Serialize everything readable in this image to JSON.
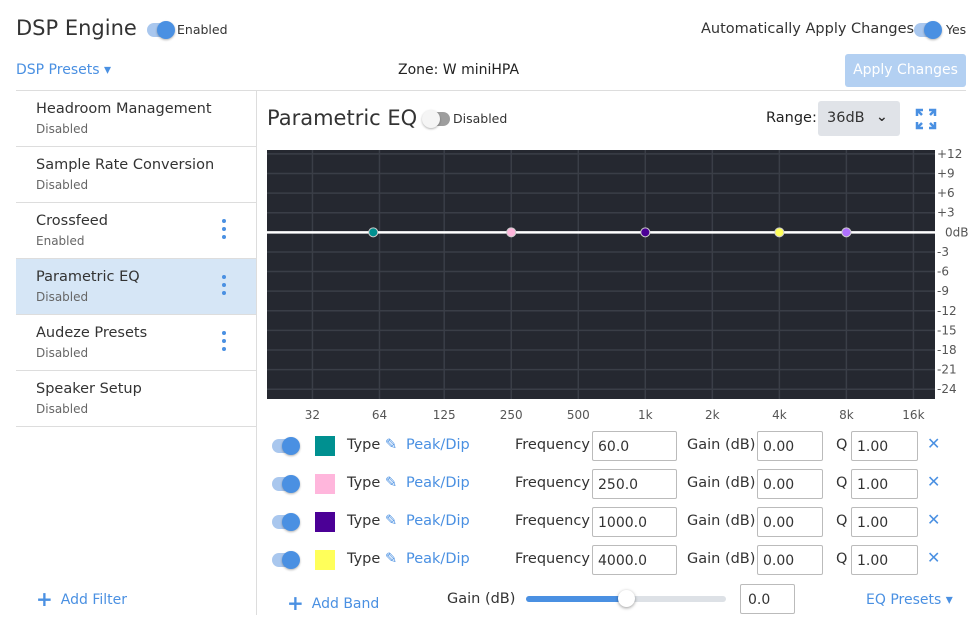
{
  "header": {
    "title": "DSP Engine",
    "engine_toggle": {
      "on": true,
      "label": "Enabled"
    },
    "auto_apply_label": "Automatically Apply Changes",
    "auto_apply_toggle": {
      "on": true,
      "label": "Yes"
    },
    "presets_label": "DSP Presets ▾",
    "zone": "Zone: W miniHPA",
    "apply_label": "Apply Changes"
  },
  "sidebar": {
    "items": [
      {
        "label": "Headroom Management",
        "status": "Disabled",
        "menu": false
      },
      {
        "label": "Sample Rate Conversion",
        "status": "Disabled",
        "menu": false
      },
      {
        "label": "Crossfeed",
        "status": "Enabled",
        "menu": true
      },
      {
        "label": "Parametric EQ",
        "status": "Disabled",
        "menu": true,
        "active": true
      },
      {
        "label": "Audeze Presets",
        "status": "Disabled",
        "menu": true
      },
      {
        "label": "Speaker Setup",
        "status": "Disabled",
        "menu": false
      }
    ],
    "add_filter": "Add Filter"
  },
  "eq": {
    "title": "Parametric EQ",
    "toggle": {
      "on": false,
      "label": "Disabled"
    },
    "range_label": "Range:",
    "range_value": "36dB",
    "expand_icon": "expand-icon"
  },
  "chart_data": {
    "type": "line",
    "x_scale": "log",
    "xlim": [
      20,
      20000
    ],
    "ylim": [
      -25.5,
      12.6
    ],
    "x_ticks": [
      {
        "v": 32,
        "l": "32"
      },
      {
        "v": 64,
        "l": "64"
      },
      {
        "v": 125,
        "l": "125"
      },
      {
        "v": 250,
        "l": "250"
      },
      {
        "v": 500,
        "l": "500"
      },
      {
        "v": 1000,
        "l": "1k"
      },
      {
        "v": 2000,
        "l": "2k"
      },
      {
        "v": 4000,
        "l": "4k"
      },
      {
        "v": 8000,
        "l": "8k"
      },
      {
        "v": 16000,
        "l": "16k"
      }
    ],
    "y_ticks": [
      {
        "v": 12,
        "l": "+12"
      },
      {
        "v": 9,
        "l": "+9"
      },
      {
        "v": 6,
        "l": "+6"
      },
      {
        "v": 3,
        "l": "+3"
      },
      {
        "v": 0,
        "l": "0dB"
      },
      {
        "v": -3,
        "l": "-3"
      },
      {
        "v": -6,
        "l": "-6"
      },
      {
        "v": -9,
        "l": "-9"
      },
      {
        "v": -12,
        "l": "-12"
      },
      {
        "v": -15,
        "l": "-15"
      },
      {
        "v": -18,
        "l": "-18"
      },
      {
        "v": -21,
        "l": "-21"
      },
      {
        "v": -24,
        "l": "-24"
      }
    ],
    "grid": true,
    "background": "#252830",
    "curve_color": "#ffffff",
    "points": [
      {
        "freq": 60,
        "gain": 0,
        "color": "#009090"
      },
      {
        "freq": 250,
        "gain": 0,
        "color": "#ffb6dc"
      },
      {
        "freq": 1000,
        "gain": 0,
        "color": "#4b0096"
      },
      {
        "freq": 4000,
        "gain": 0,
        "color": "#ffff5a"
      },
      {
        "freq": 8000,
        "gain": 0,
        "color": "#b070ff"
      }
    ]
  },
  "bands": [
    {
      "on": true,
      "color": "#009090",
      "type_label": "Type",
      "type": "Peak/Dip",
      "freq_label": "Frequency",
      "freq": "60.0",
      "gain_label": "Gain (dB)",
      "gain": "0.00",
      "q_label": "Q",
      "q": "1.00"
    },
    {
      "on": true,
      "color": "#ffb6dc",
      "type_label": "Type",
      "type": "Peak/Dip",
      "freq_label": "Frequency",
      "freq": "250.0",
      "gain_label": "Gain (dB)",
      "gain": "0.00",
      "q_label": "Q",
      "q": "1.00"
    },
    {
      "on": true,
      "color": "#4b0096",
      "type_label": "Type",
      "type": "Peak/Dip",
      "freq_label": "Frequency",
      "freq": "1000.0",
      "gain_label": "Gain (dB)",
      "gain": "0.00",
      "q_label": "Q",
      "q": "1.00"
    },
    {
      "on": true,
      "color": "#ffff5a",
      "type_label": "Type",
      "type": "Peak/Dip",
      "freq_label": "Frequency",
      "freq": "4000.0",
      "gain_label": "Gain (dB)",
      "gain": "0.00",
      "q_label": "Q",
      "q": "1.00"
    }
  ],
  "footer": {
    "add_band": "Add Band",
    "gain_label": "Gain (dB)",
    "gain_slider_fraction": 0.5,
    "gain_value": "0.0",
    "eq_presets": "EQ Presets ▾"
  },
  "colors": {
    "accent": "#4a90e2",
    "apply_disabled": "#b3d0f2"
  }
}
